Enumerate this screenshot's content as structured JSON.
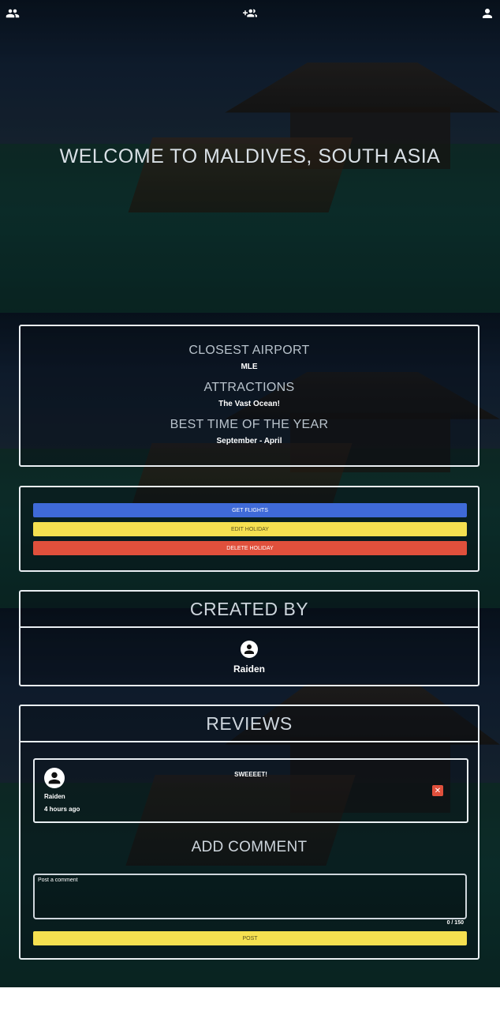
{
  "nav": {
    "left_icon": "group-icon",
    "center_icon": "group-add-icon",
    "right_icon": "person-icon"
  },
  "hero": {
    "title": "WELCOME TO MALDIVES, SOUTH ASIA"
  },
  "info": {
    "airport_label": "CLOSEST AIRPORT",
    "airport_value": "MLE",
    "attractions_label": "ATTRACTIONS",
    "attractions_value": "The Vast Ocean!",
    "best_time_label": "BEST TIME OF THE YEAR",
    "best_time_value": "September - April"
  },
  "actions": {
    "get_flights": "GET FLIGHTS",
    "edit_holiday": "EDIT HOLIDAY",
    "delete_holiday": "DELETE HOLIDAY"
  },
  "created_by": {
    "title": "CREATED BY",
    "name": "Raiden"
  },
  "reviews": {
    "title": "REVIEWS",
    "items": [
      {
        "user": "Raiden",
        "time": "4 hours ago",
        "text": "SWEEEET!"
      }
    ]
  },
  "add_comment": {
    "title": "ADD COMMENT",
    "placeholder": "Post a comment",
    "counter": "0 / 150",
    "post_label": "POST"
  },
  "colors": {
    "blue": "#3f6ad8",
    "yellow": "#f5e050",
    "red": "#e0503c"
  }
}
